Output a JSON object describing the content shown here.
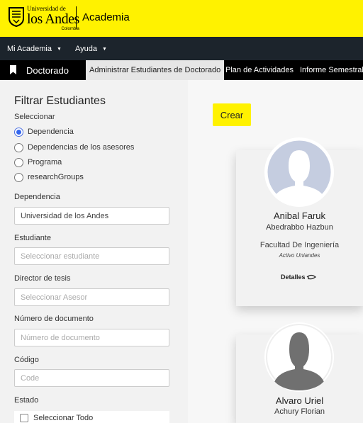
{
  "header": {
    "logo_university_line": "Universidad de",
    "logo_name_line": "los Andes",
    "logo_country_line": "Colombia",
    "app_name": "Academia",
    "brand_color": "#fff200"
  },
  "menu": {
    "items": [
      {
        "label": "Mi Academia",
        "icon": "caret-down-icon"
      },
      {
        "label": "Ayuda",
        "icon": "caret-down-icon"
      }
    ]
  },
  "subnav": {
    "section_icon": "bookmark-icon",
    "section_title": "Doctorado",
    "tabs": [
      {
        "label": "Administrar Estudiantes de Doctorado",
        "active": true
      },
      {
        "label": "Plan de Actividades",
        "active": false
      },
      {
        "label": "Informe Semestral",
        "active": false
      }
    ]
  },
  "filters": {
    "title": "Filtrar Estudiantes",
    "select_label": "Seleccionar",
    "radio_options": [
      {
        "label": "Dependencia",
        "checked": true
      },
      {
        "label": "Dependencias de los asesores",
        "checked": false
      },
      {
        "label": "Programa",
        "checked": false
      },
      {
        "label": "researchGroups",
        "checked": false
      }
    ],
    "dependencia": {
      "label": "Dependencia",
      "value": "Universidad de los Andes"
    },
    "estudiante": {
      "label": "Estudiante",
      "placeholder": "Seleccionar estudiante"
    },
    "director": {
      "label": "Director de tesis",
      "placeholder": "Seleccionar Asesor"
    },
    "documento": {
      "label": "Número de documento",
      "placeholder": "Número de documento"
    },
    "codigo": {
      "label": "Código",
      "placeholder": "Code"
    },
    "estado": {
      "label": "Estado",
      "select_all": "Seleccionar Todo",
      "checked": false
    }
  },
  "main": {
    "create_button": "Crear",
    "students": [
      {
        "first_name": "Anibal Faruk",
        "last_name": "Abedrabbo Hazbun",
        "faculty": "Facultad De Ingeniería",
        "status": "Activo Uniandes",
        "details": "Detalles",
        "avatar_icon": "person-placeholder-icon",
        "avatar_color": "#c5cde0"
      },
      {
        "first_name": "Alvaro Uriel",
        "last_name": "Achury Florian",
        "avatar_icon": "person-placeholder-icon",
        "avatar_color": "#707070"
      }
    ]
  }
}
